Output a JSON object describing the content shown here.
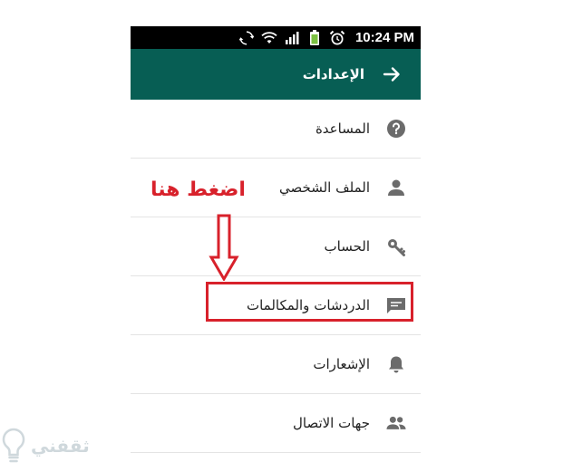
{
  "status_bar": {
    "time": "10:24 PM",
    "icons": [
      "sync-icon",
      "wifi-icon",
      "signal-icon",
      "battery-icon",
      "alarm-icon"
    ]
  },
  "app_bar": {
    "title": "الإعدادات",
    "back_icon": "arrow-back-icon"
  },
  "settings": [
    {
      "label": "المساعدة",
      "icon": "help-icon"
    },
    {
      "label": "الملف الشخصي",
      "icon": "person-icon"
    },
    {
      "label": "الحساب",
      "icon": "key-icon"
    },
    {
      "label": "الدردشات والمكالمات",
      "icon": "chat-icon"
    },
    {
      "label": "الإشعارات",
      "icon": "bell-icon"
    },
    {
      "label": "جهات الاتصال",
      "icon": "contacts-icon"
    }
  ],
  "annotation": {
    "text": "اضغط هنا",
    "color": "#d8212b"
  },
  "watermark": {
    "text": "ثقفني"
  },
  "colors": {
    "app_bar": "#075e54",
    "icon": "#6b6b6b",
    "highlight": "#d8212b"
  }
}
